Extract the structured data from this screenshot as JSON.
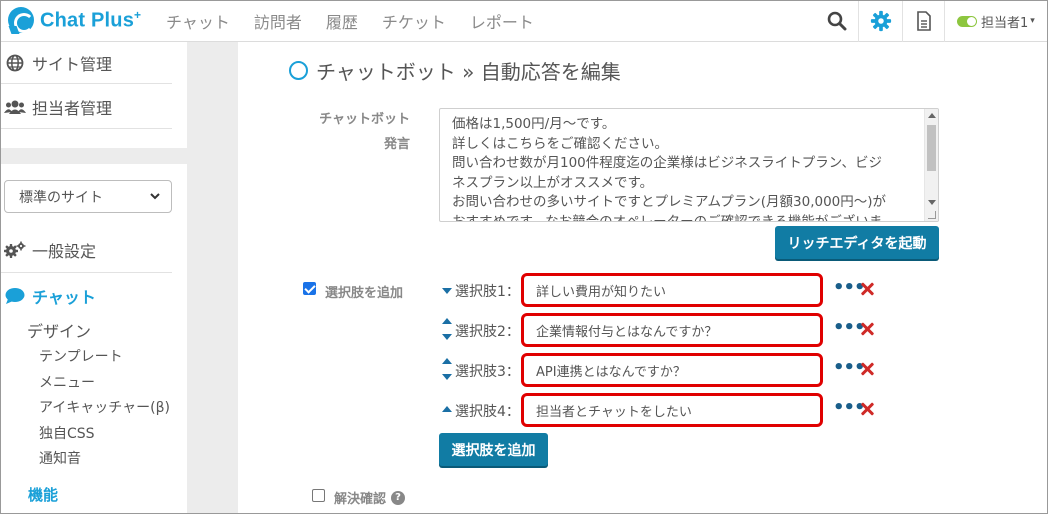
{
  "header": {
    "logo_text": "Chat Plus",
    "logo_plus": "+",
    "nav": [
      {
        "label": "チャット"
      },
      {
        "label": "訪問者"
      },
      {
        "label": "履歴"
      },
      {
        "label": "チケット"
      },
      {
        "label": "レポート"
      }
    ],
    "user": {
      "name": "担当者1",
      "caret": "▾"
    },
    "colors": {
      "brand": "#1aa0d8",
      "gear": "#1aa0d8",
      "toggle": "#8dc63f"
    }
  },
  "sidebar": {
    "top": [
      {
        "label": "サイト管理",
        "icon": "globe-icon"
      },
      {
        "label": "担当者管理",
        "icon": "users-icon"
      }
    ],
    "site_select": {
      "value": "標準のサイト"
    },
    "general": {
      "label": "一般設定",
      "icon": "gears-icon"
    },
    "chat": {
      "label": "チャット",
      "icon": "chat-bubble-icon"
    },
    "design": {
      "label": "デザイン"
    },
    "design_items": [
      {
        "label": "テンプレート"
      },
      {
        "label": "メニュー"
      },
      {
        "label": "アイキャッチャー(β)"
      },
      {
        "label": "独自CSS"
      },
      {
        "label": "通知音"
      }
    ],
    "function": {
      "label": "機能"
    }
  },
  "main": {
    "title": "チャットボット » 自動応答を編集",
    "utterance_label_1": "チャットボット",
    "utterance_label_2": "発言",
    "utterance_lines": [
      "価格は1,500円/月～です。",
      "詳しくはこちらをご確認ください。",
      "問い合わせ数が月100件程度迄の企業様はビジネスライトプラン、ビジ",
      "ネスプラン以上がオススメです。",
      "お問い合わせの多いサイトですとプレミアムプラン(月額30,000円～)が",
      "おすすめです。なお競合のオペレーターのご確認できる機能がございま"
    ],
    "rich_editor_button": "リッチエディタを起動",
    "add_options_checkbox": {
      "label": "選択肢を追加",
      "checked": true
    },
    "options": [
      {
        "label": "選択肢1：",
        "value": "詳しい費用が知りたい",
        "up": false,
        "down": true
      },
      {
        "label": "選択肢2：",
        "value": "企業情報付与とはなんですか？",
        "up": true,
        "down": true
      },
      {
        "label": "選択肢3：",
        "value": "API連携とはなんですか？",
        "up": true,
        "down": true
      },
      {
        "label": "選択肢4：",
        "value": "担当者とチャットをしたい",
        "up": true,
        "down": false
      }
    ],
    "more_glyph": "•••",
    "add_option_button": "選択肢を追加",
    "resolve_checkbox": {
      "label": "解決確認",
      "checked": false
    },
    "help_glyph": "?",
    "colors": {
      "highlight": "#e00000",
      "button": "#117ca4",
      "delete": "#cf2a27"
    }
  }
}
